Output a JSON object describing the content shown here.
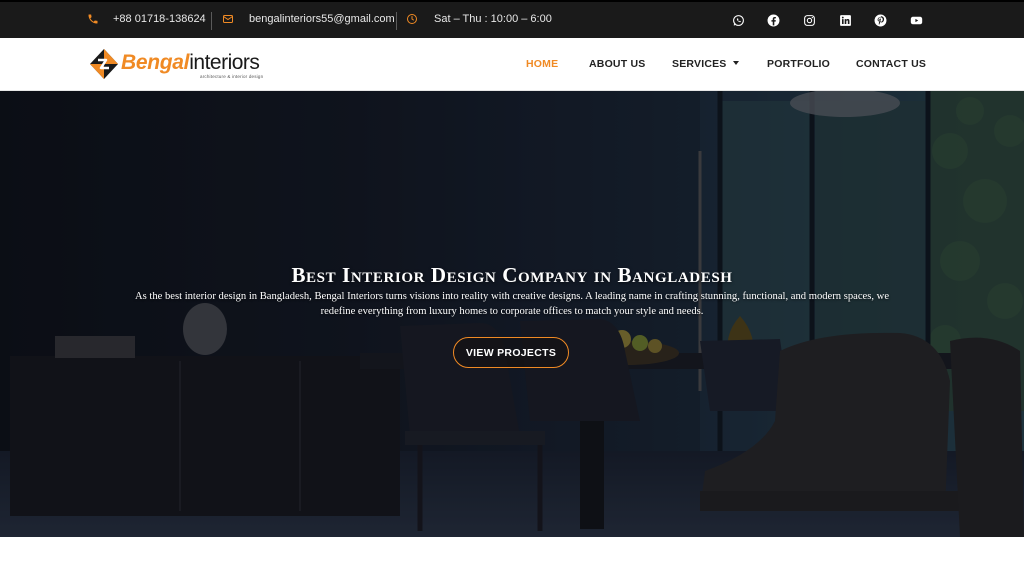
{
  "topbar": {
    "phone": "+88 01718-138624",
    "email": "bengalinteriors55@gmail.com",
    "hours": "Sat – Thu : 10:00 – 6:00",
    "accent_color": "#f08a24",
    "social": [
      "whatsapp-icon",
      "facebook-icon",
      "instagram-icon",
      "linkedin-icon",
      "pinterest-icon",
      "youtube-icon"
    ]
  },
  "logo": {
    "brand": "Bengal",
    "word": "interiors",
    "tagline": "architecture & interior design"
  },
  "nav": {
    "items": [
      {
        "label": "HOME",
        "active": true
      },
      {
        "label": "ABOUT US",
        "active": false
      },
      {
        "label": "SERVICES",
        "active": false,
        "has_dropdown": true
      },
      {
        "label": "PORTFOLIO",
        "active": false
      },
      {
        "label": "CONTACT US",
        "active": false
      }
    ]
  },
  "hero": {
    "title": "Best Interior Design Company in Bangladesh",
    "description": "As the best interior design in Bangladesh, Bengal Interiors turns visions into reality with creative designs. A leading name in crafting stunning, functional, and modern spaces, we redefine everything from luxury homes to corporate offices to match your style and needs.",
    "button_label": "VIEW PROJECTS"
  }
}
